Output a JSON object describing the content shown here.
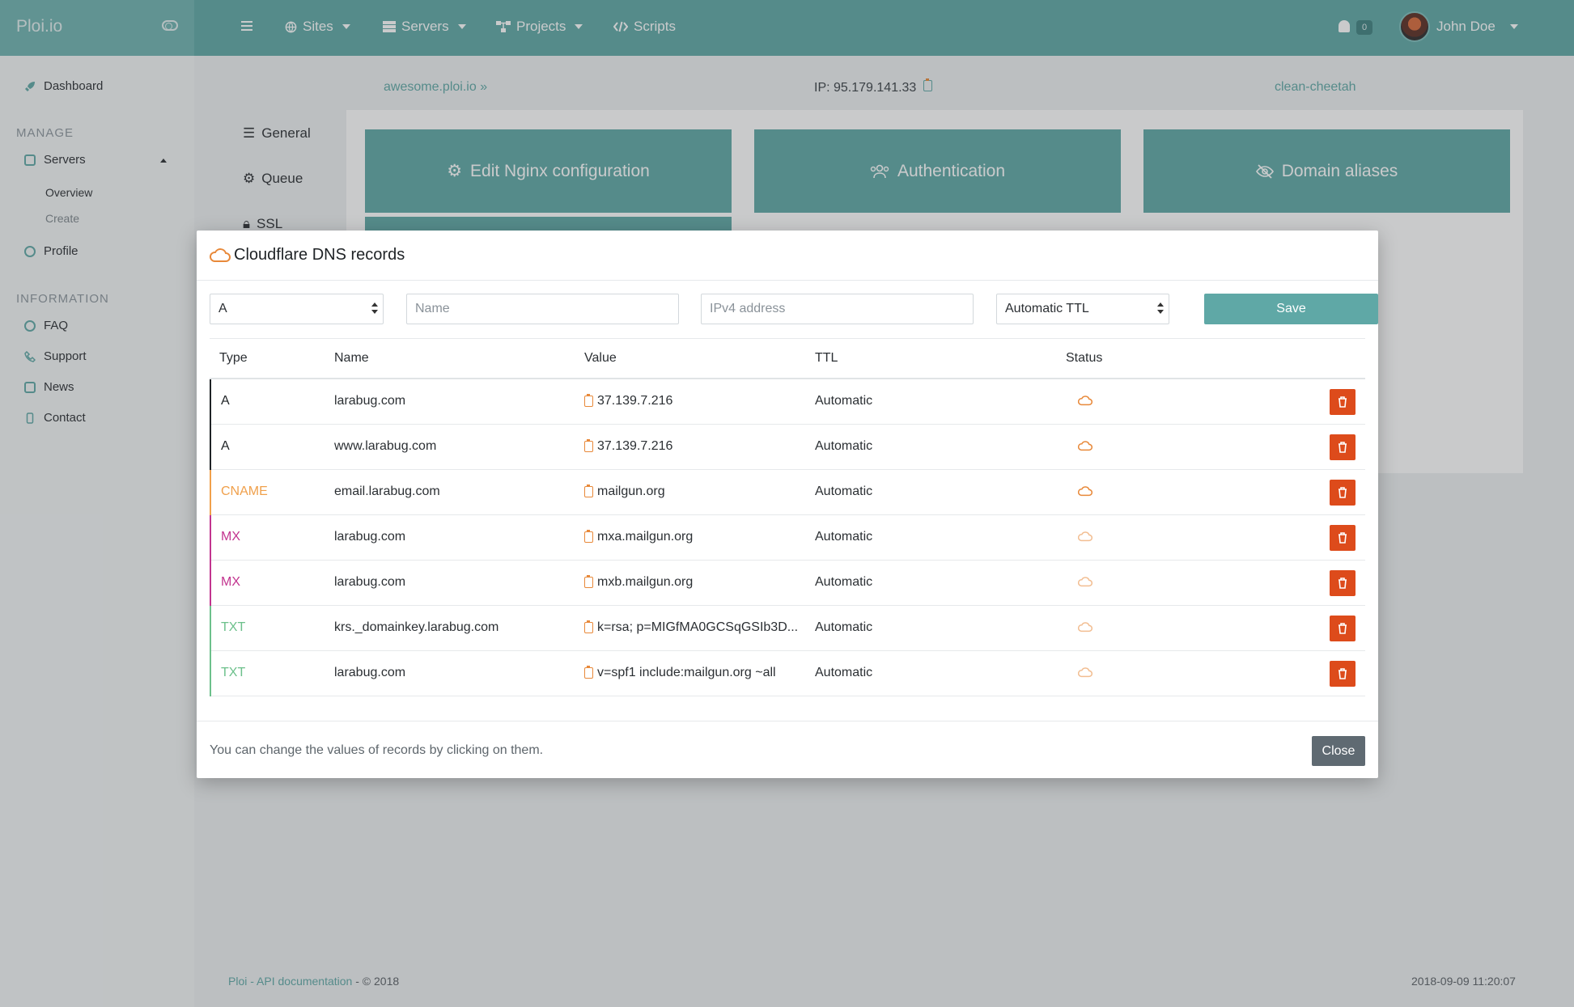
{
  "brand": "Ploi.io",
  "topnav": {
    "sites": "Sites",
    "servers": "Servers",
    "projects": "Projects",
    "scripts": "Scripts",
    "notifications": "0",
    "user": "John Doe"
  },
  "sidebar": {
    "dashboard": "Dashboard",
    "manage_heading": "MANAGE",
    "servers": "Servers",
    "overview": "Overview",
    "create": "Create",
    "profile": "Profile",
    "information_heading": "INFORMATION",
    "faq": "FAQ",
    "support": "Support",
    "news": "News",
    "contact": "Contact"
  },
  "server": {
    "name": "awesome.ploi.io",
    "ip": "IP: 95.179.141.33",
    "hostname": "clean-cheetah"
  },
  "side_tabs": {
    "general": "General",
    "queue": "Queue",
    "ssl": "SSL"
  },
  "tiles": {
    "nginx": "Edit Nginx configuration",
    "auth": "Authentication",
    "aliases": "Domain aliases"
  },
  "modal": {
    "title": "Cloudflare DNS records",
    "form": {
      "type_value": "A",
      "name_placeholder": "Name",
      "value_placeholder": "IPv4 address",
      "ttl_value": "Automatic TTL",
      "save_label": "Save"
    },
    "columns": {
      "type": "Type",
      "name": "Name",
      "value": "Value",
      "ttl": "TTL",
      "status": "Status"
    },
    "records": [
      {
        "type": "A",
        "name": "larabug.com",
        "value": "37.139.7.216",
        "ttl": "Automatic",
        "color": "#1f2326",
        "proxied": true
      },
      {
        "type": "A",
        "name": "www.larabug.com",
        "value": "37.139.7.216",
        "ttl": "Automatic",
        "color": "#1f2326",
        "proxied": true
      },
      {
        "type": "CNAME",
        "name": "email.larabug.com",
        "value": "mailgun.org",
        "ttl": "Automatic",
        "color": "#f0a04b",
        "proxied": true
      },
      {
        "type": "MX",
        "name": "larabug.com",
        "value": "mxa.mailgun.org",
        "ttl": "Automatic",
        "color": "#c2348f",
        "proxied": false
      },
      {
        "type": "MX",
        "name": "larabug.com",
        "value": "mxb.mailgun.org",
        "ttl": "Automatic",
        "color": "#c2348f",
        "proxied": false
      },
      {
        "type": "TXT",
        "name": "krs._domainkey.larabug.com",
        "value": "k=rsa; p=MIGfMA0GCSqGSIb3D...",
        "ttl": "Automatic",
        "color": "#6cc08b",
        "proxied": false
      },
      {
        "type": "TXT",
        "name": "larabug.com",
        "value": "v=spf1 include:mailgun.org ~all",
        "ttl": "Automatic",
        "color": "#6cc08b",
        "proxied": false
      }
    ],
    "footer_note": "You can change the values of records by clicking on them.",
    "close_label": "Close"
  },
  "footer": {
    "ploi": "Ploi",
    "sep": "-",
    "api_docs": "API documentation",
    "copyright": "- © 2018",
    "timestamp": "2018-09-09 11:20:07"
  },
  "colors": {
    "accent": "#5fa8a6",
    "danger": "#dd4b1b",
    "cloud": "#e8893a"
  }
}
